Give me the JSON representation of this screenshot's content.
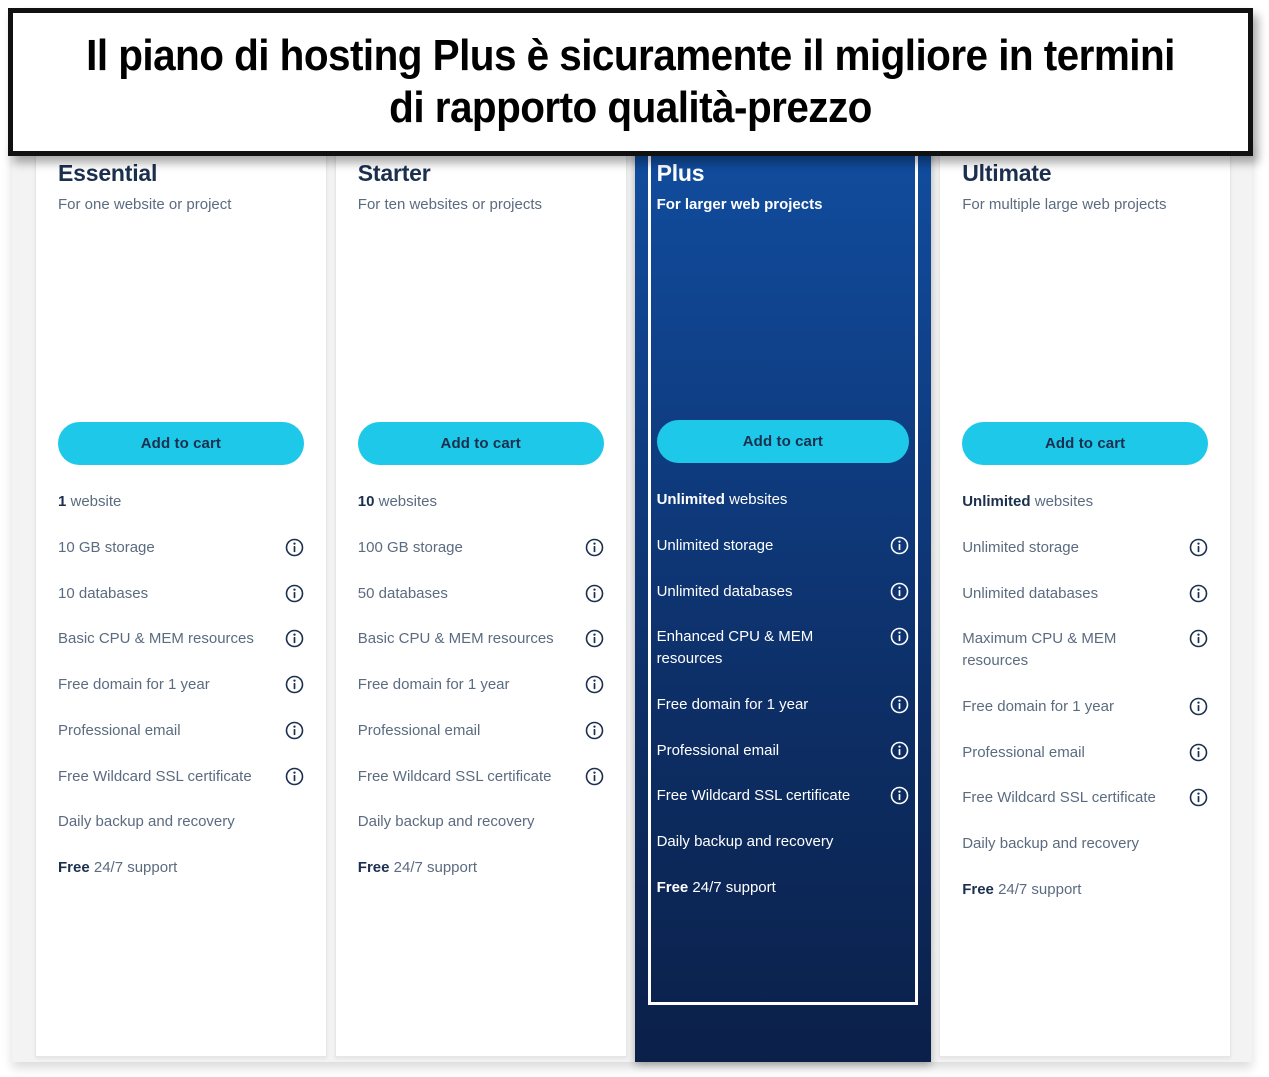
{
  "banner": {
    "text": "Il piano di hosting Plus è sicuramente il migliore in termini di rapporto qualità-prezzo"
  },
  "colors": {
    "accent_cyan": "#1ec8e8",
    "navy_text": "#1b2f4e",
    "muted_text": "#5b6b80",
    "featured_top": "#114d9e",
    "featured_bottom": "#0b2049",
    "page_surface": "#f3f3f3",
    "banner_border": "#111111"
  },
  "icons": {
    "info": "info-circle-icon"
  },
  "plans": [
    {
      "name": "Essential",
      "tagline": "For one website or project",
      "featured": false,
      "cta_label": "Add to cart",
      "features": [
        {
          "bold": "1",
          "text": " website",
          "info": false
        },
        {
          "bold": "",
          "text": "10 GB storage",
          "info": true
        },
        {
          "bold": "",
          "text": "10 databases",
          "info": true
        },
        {
          "bold": "",
          "text": "Basic CPU & MEM resources",
          "info": true
        },
        {
          "bold": "",
          "text": "Free domain for 1 year",
          "info": true
        },
        {
          "bold": "",
          "text": "Professional email",
          "info": true
        },
        {
          "bold": "",
          "text": "Free Wildcard SSL certificate",
          "info": true
        },
        {
          "bold": "",
          "text": "Daily backup and recovery",
          "info": false
        },
        {
          "bold": "Free",
          "text": " 24/7 support",
          "info": false
        }
      ]
    },
    {
      "name": "Starter",
      "tagline": "For ten websites or projects",
      "featured": false,
      "cta_label": "Add to cart",
      "features": [
        {
          "bold": "10",
          "text": " websites",
          "info": false
        },
        {
          "bold": "",
          "text": "100 GB storage",
          "info": true
        },
        {
          "bold": "",
          "text": "50 databases",
          "info": true
        },
        {
          "bold": "",
          "text": "Basic CPU & MEM resources",
          "info": true
        },
        {
          "bold": "",
          "text": "Free domain for 1 year",
          "info": true
        },
        {
          "bold": "",
          "text": "Professional email",
          "info": true
        },
        {
          "bold": "",
          "text": "Free Wildcard SSL certificate",
          "info": true
        },
        {
          "bold": "",
          "text": "Daily backup and recovery",
          "info": false
        },
        {
          "bold": "Free",
          "text": " 24/7 support",
          "info": false
        }
      ]
    },
    {
      "name": "Plus",
      "tagline": "For larger web projects",
      "featured": true,
      "cta_label": "Add to cart",
      "features": [
        {
          "bold": "Unlimited",
          "text": " websites",
          "info": false
        },
        {
          "bold": "",
          "text": "Unlimited storage",
          "info": true
        },
        {
          "bold": "",
          "text": "Unlimited databases",
          "info": true
        },
        {
          "bold": "",
          "text": "Enhanced CPU & MEM resources",
          "info": true
        },
        {
          "bold": "",
          "text": "Free domain for 1 year",
          "info": true
        },
        {
          "bold": "",
          "text": "Professional email",
          "info": true
        },
        {
          "bold": "",
          "text": "Free Wildcard SSL certificate",
          "info": true
        },
        {
          "bold": "",
          "text": "Daily backup and recovery",
          "info": false
        },
        {
          "bold": "Free",
          "text": " 24/7 support",
          "info": false
        }
      ]
    },
    {
      "name": "Ultimate",
      "tagline": "For multiple large web projects",
      "featured": false,
      "cta_label": "Add to cart",
      "features": [
        {
          "bold": "Unlimited",
          "text": " websites",
          "info": false
        },
        {
          "bold": "",
          "text": "Unlimited storage",
          "info": true
        },
        {
          "bold": "",
          "text": "Unlimited databases",
          "info": true
        },
        {
          "bold": "",
          "text": "Maximum CPU & MEM resources",
          "info": true
        },
        {
          "bold": "",
          "text": "Free domain for 1 year",
          "info": true
        },
        {
          "bold": "",
          "text": "Professional email",
          "info": true
        },
        {
          "bold": "",
          "text": "Free Wildcard SSL certificate",
          "info": true
        },
        {
          "bold": "",
          "text": "Daily backup and recovery",
          "info": false
        },
        {
          "bold": "Free",
          "text": " 24/7 support",
          "info": false
        }
      ]
    }
  ]
}
